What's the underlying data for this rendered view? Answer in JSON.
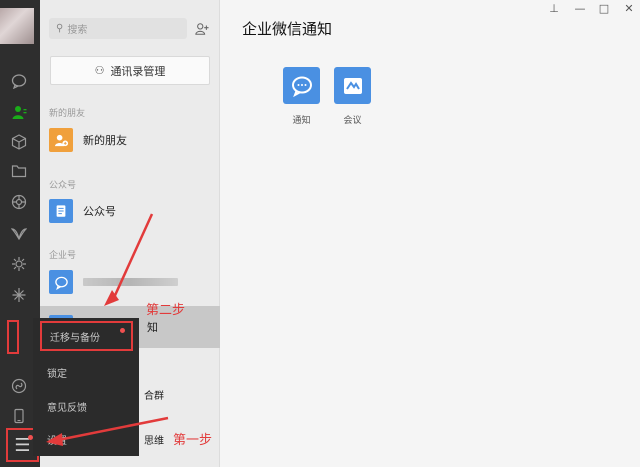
{
  "rail": {
    "icons": [
      "chat-icon",
      "contacts-icon",
      "favorites-icon",
      "folder-icon",
      "moments-icon",
      "channels-icon",
      "miniprogram-icon",
      "search-discover-icon",
      "miniprogram-panel-icon",
      "phone-icon",
      "menu-icon"
    ]
  },
  "contacts": {
    "search_placeholder": "搜索",
    "manage_button": "通讯录管理",
    "sections": {
      "new_friends_label": "新的朋友",
      "new_friends_item": "新的朋友",
      "official_label": "公众号",
      "official_item": "公众号",
      "enterprise_label": "企业号",
      "enterprise_item_tail": "知"
    },
    "partial_rows": [
      "合群",
      "思维"
    ]
  },
  "popup_menu": {
    "items": [
      "迁移与备份",
      "锁定",
      "意见反馈",
      "设置"
    ]
  },
  "main": {
    "title": "企业微信通知",
    "apps": [
      {
        "label": "通知",
        "icon": "chat-bubble-icon"
      },
      {
        "label": "会议",
        "icon": "meeting-icon"
      }
    ]
  },
  "annotations": {
    "step1": "第一步",
    "step2": "第二步",
    "color": "#e23b3b"
  },
  "colors": {
    "rail_bg": "#2e2e2e",
    "accent_green": "#1aad19",
    "tile_orange": "#f0a03c",
    "tile_blue": "#4a90e2"
  }
}
